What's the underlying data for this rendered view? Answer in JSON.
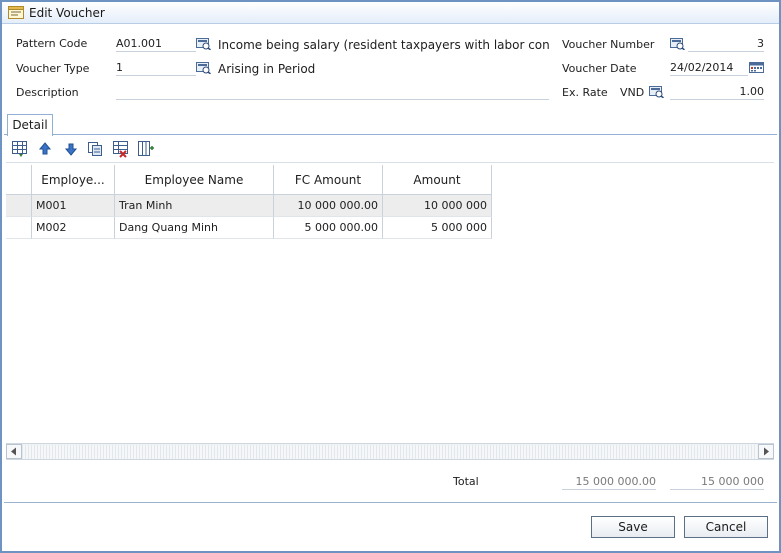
{
  "window": {
    "title": "Edit Voucher"
  },
  "header": {
    "pattern_code": {
      "label": "Pattern Code",
      "value": "A01.001",
      "description": "Income being salary (resident taxpayers with labor contra"
    },
    "voucher_type": {
      "label": "Voucher Type",
      "value": "1",
      "description": "Arising in Period"
    },
    "description": {
      "label": "Description",
      "value": ""
    },
    "voucher_number": {
      "label": "Voucher Number",
      "value": "3"
    },
    "voucher_date": {
      "label": "Voucher Date",
      "value": "24/02/2014"
    },
    "ex_rate": {
      "label": "Ex. Rate",
      "currency": "VND",
      "value": "1.00"
    }
  },
  "tabs": [
    {
      "label": "Detail"
    }
  ],
  "toolbar": {
    "icons": [
      "add-row-icon",
      "move-up-icon",
      "move-down-icon",
      "copy-row-icon",
      "delete-row-icon",
      "columns-icon"
    ]
  },
  "grid": {
    "columns": [
      "Employe...",
      "Employee Name",
      "FC Amount",
      "Amount"
    ],
    "rows": [
      {
        "code": "M001",
        "name": "Tran Minh",
        "fc_amount": "10 000 000.00",
        "amount": "10 000 000"
      },
      {
        "code": "M002",
        "name": "Dang Quang Minh",
        "fc_amount": "5 000 000.00",
        "amount": "5 000 000"
      }
    ]
  },
  "totals": {
    "label": "Total",
    "fc_amount": "15 000 000.00",
    "amount": "15 000 000"
  },
  "buttons": {
    "save": "Save",
    "cancel": "Cancel"
  },
  "colors": {
    "window_border": "#6e93c2",
    "tab_border": "#93afd4",
    "alt_row": "#ededed"
  }
}
